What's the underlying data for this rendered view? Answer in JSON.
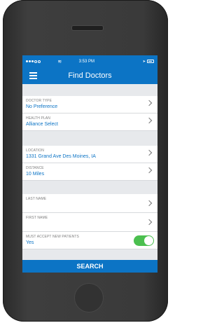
{
  "status": {
    "signal": "●●●○○",
    "time": "3:53 PM"
  },
  "navbar": {
    "title": "Find Doctors",
    "menu_icon": "hamburger-icon"
  },
  "section1": [
    {
      "label": "DOCTOR TYPE",
      "value": "No Preference"
    },
    {
      "label": "HEALTH PLAN",
      "value": "Alliance Select"
    }
  ],
  "section2": [
    {
      "label": "LOCATION",
      "value": "1331 Grand Ave Des Moines, IA"
    },
    {
      "label": "DISTANCE",
      "value": "10 Miles"
    }
  ],
  "section3": [
    {
      "label": "LAST NAME",
      "value": ""
    },
    {
      "label": "FIRST NAME",
      "value": ""
    }
  ],
  "accept": {
    "label": "MUST ACCEPT NEW PATIENTS",
    "value": "Yes",
    "toggle_on": true
  },
  "search_button": "SEARCH",
  "colors": {
    "primary": "#0c74c5",
    "toggle": "#4bbf4f",
    "background": "#e7e9ec"
  }
}
